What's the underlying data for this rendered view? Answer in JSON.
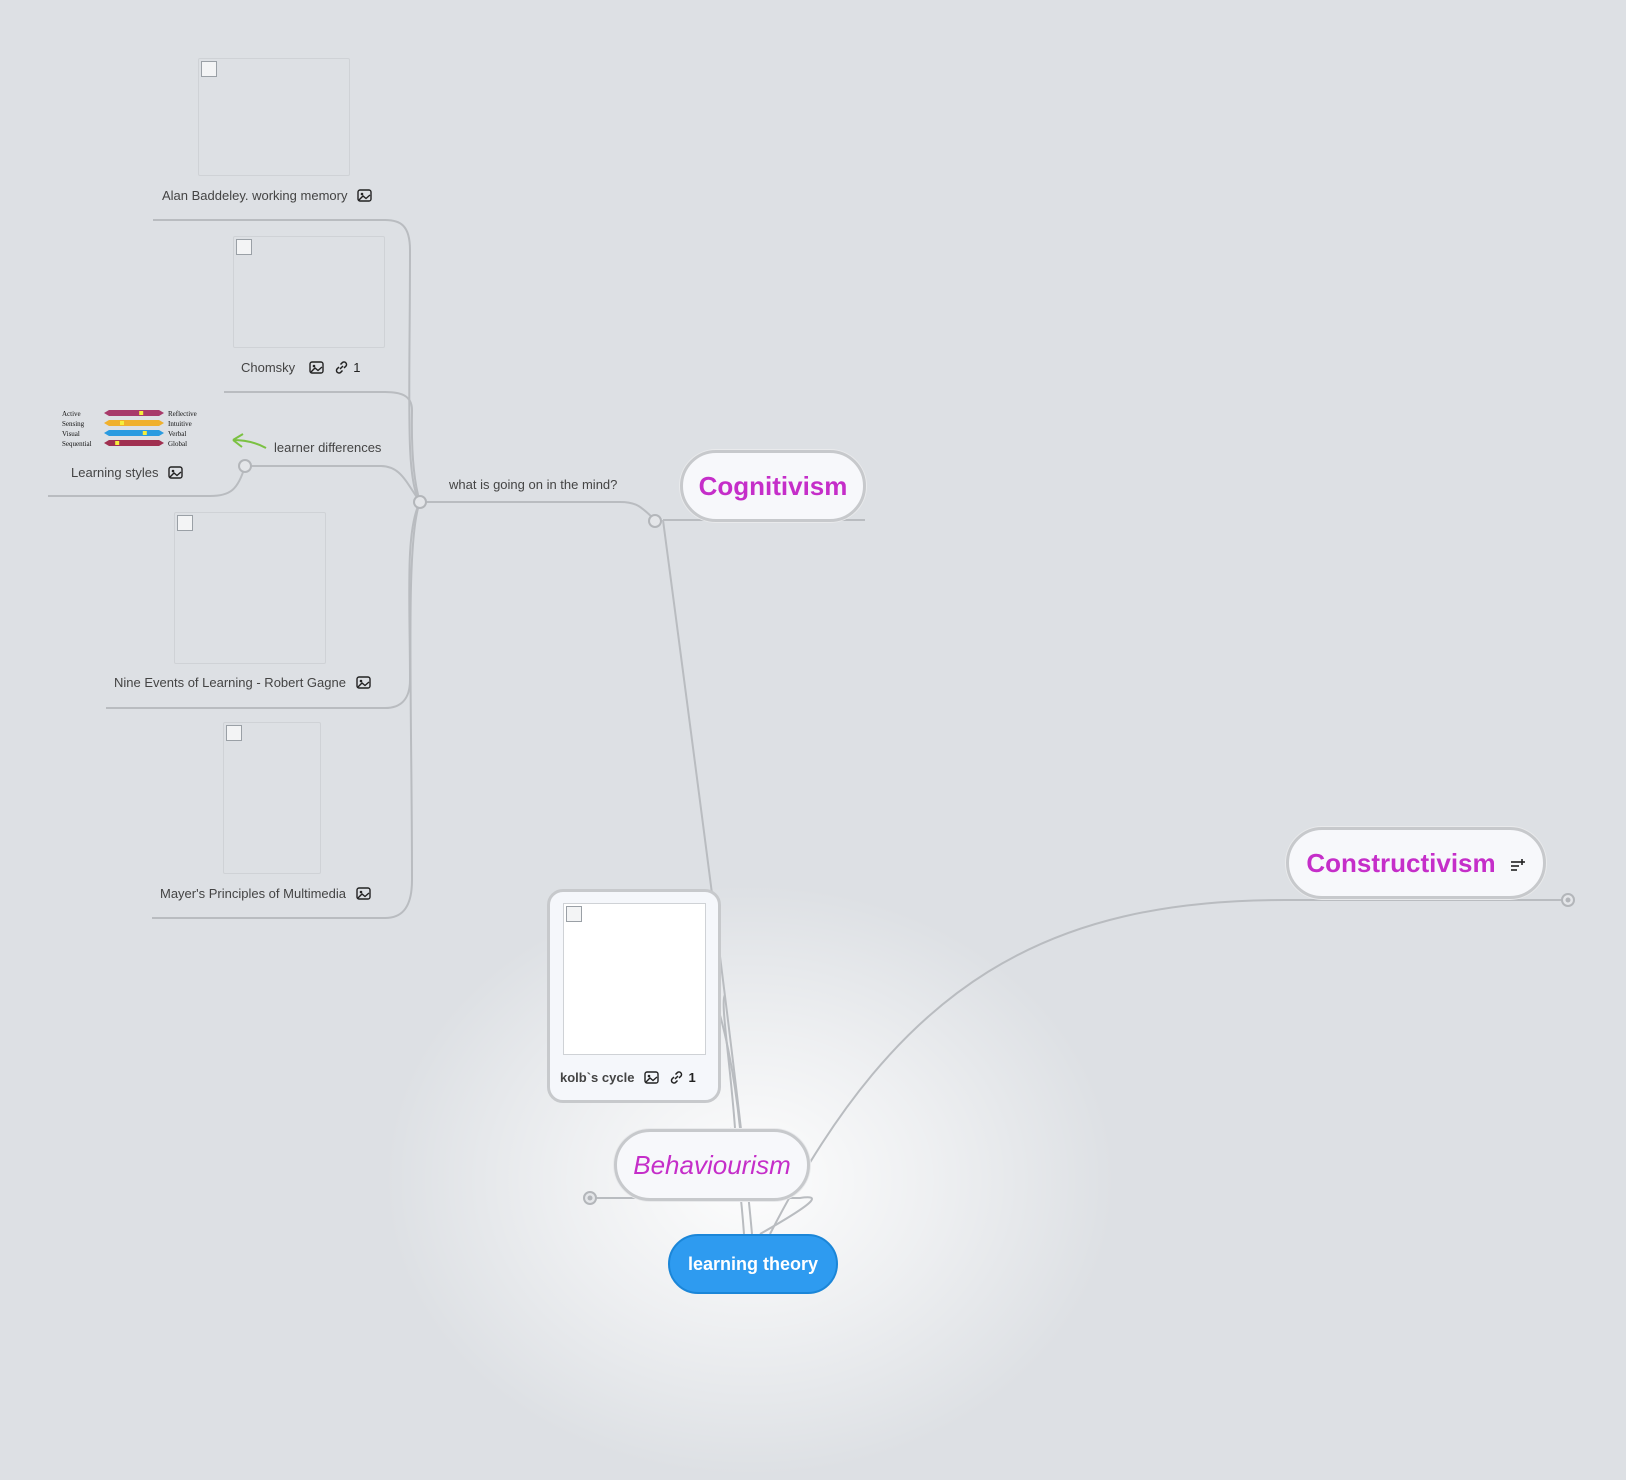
{
  "central": {
    "label": "learning theory"
  },
  "topics": {
    "cognitivism": "Cognitivism",
    "behaviourism": "Behaviourism",
    "constructivism": "Constructivism"
  },
  "cognitivism_branch": {
    "label": "what is going on in the mind?",
    "children": [
      {
        "label": "Alan Baddeley. working memory",
        "link_count": ""
      },
      {
        "label": "Chomsky",
        "link_count": "1"
      },
      {
        "label": "Learning styles",
        "link_count": ""
      },
      {
        "label": "Nine Events of Learning - Robert Gagne",
        "link_count": ""
      },
      {
        "label": "Mayer's Principles of Multimedia",
        "link_count": ""
      }
    ],
    "learner_differences": "learner differences",
    "styles_chart": {
      "left": [
        "Active",
        "Sensing",
        "Visual",
        "Sequential"
      ],
      "right": [
        "Reflective",
        "Intuitive",
        "Verbal",
        "Global"
      ],
      "bar_colors": [
        "#a83a6a",
        "#f0b02c",
        "#2a9be0",
        "#a03050"
      ]
    }
  },
  "behaviourism_branch": {
    "kolb": {
      "label": "kolb`s cycle",
      "link_count": "1"
    }
  },
  "colors": {
    "topic_text": "#c52ec9",
    "central_fill": "#2e9bf0",
    "arrow": "#7bc142"
  }
}
